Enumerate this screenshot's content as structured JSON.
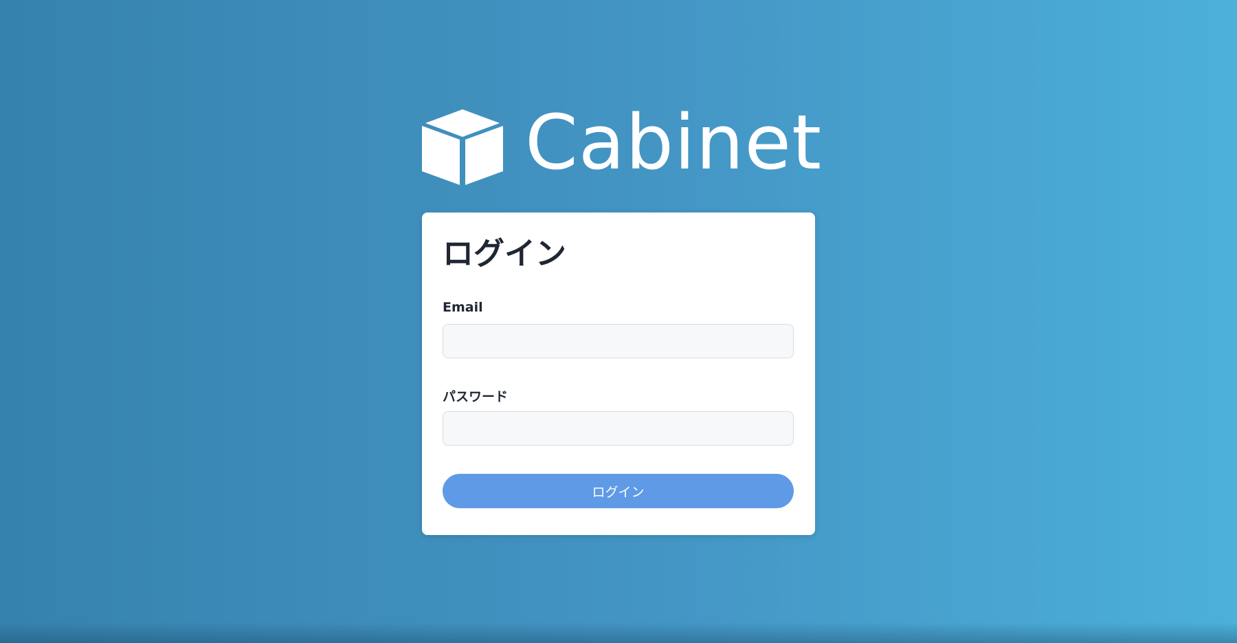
{
  "brand": {
    "name": "Cabinet",
    "logo_icon": "cube-icon",
    "color": "#ffffff"
  },
  "login_card": {
    "title": "ログイン",
    "email_label": "Email",
    "email_value": "",
    "email_placeholder": "",
    "password_label": "パスワード",
    "password_value": "",
    "password_placeholder": "",
    "submit_label": "ログイン"
  },
  "colors": {
    "background_start": "#3682ae",
    "background_end": "#4cb0da",
    "button": "#5f9ae6",
    "card": "#ffffff",
    "text_dark": "#1f2733"
  }
}
